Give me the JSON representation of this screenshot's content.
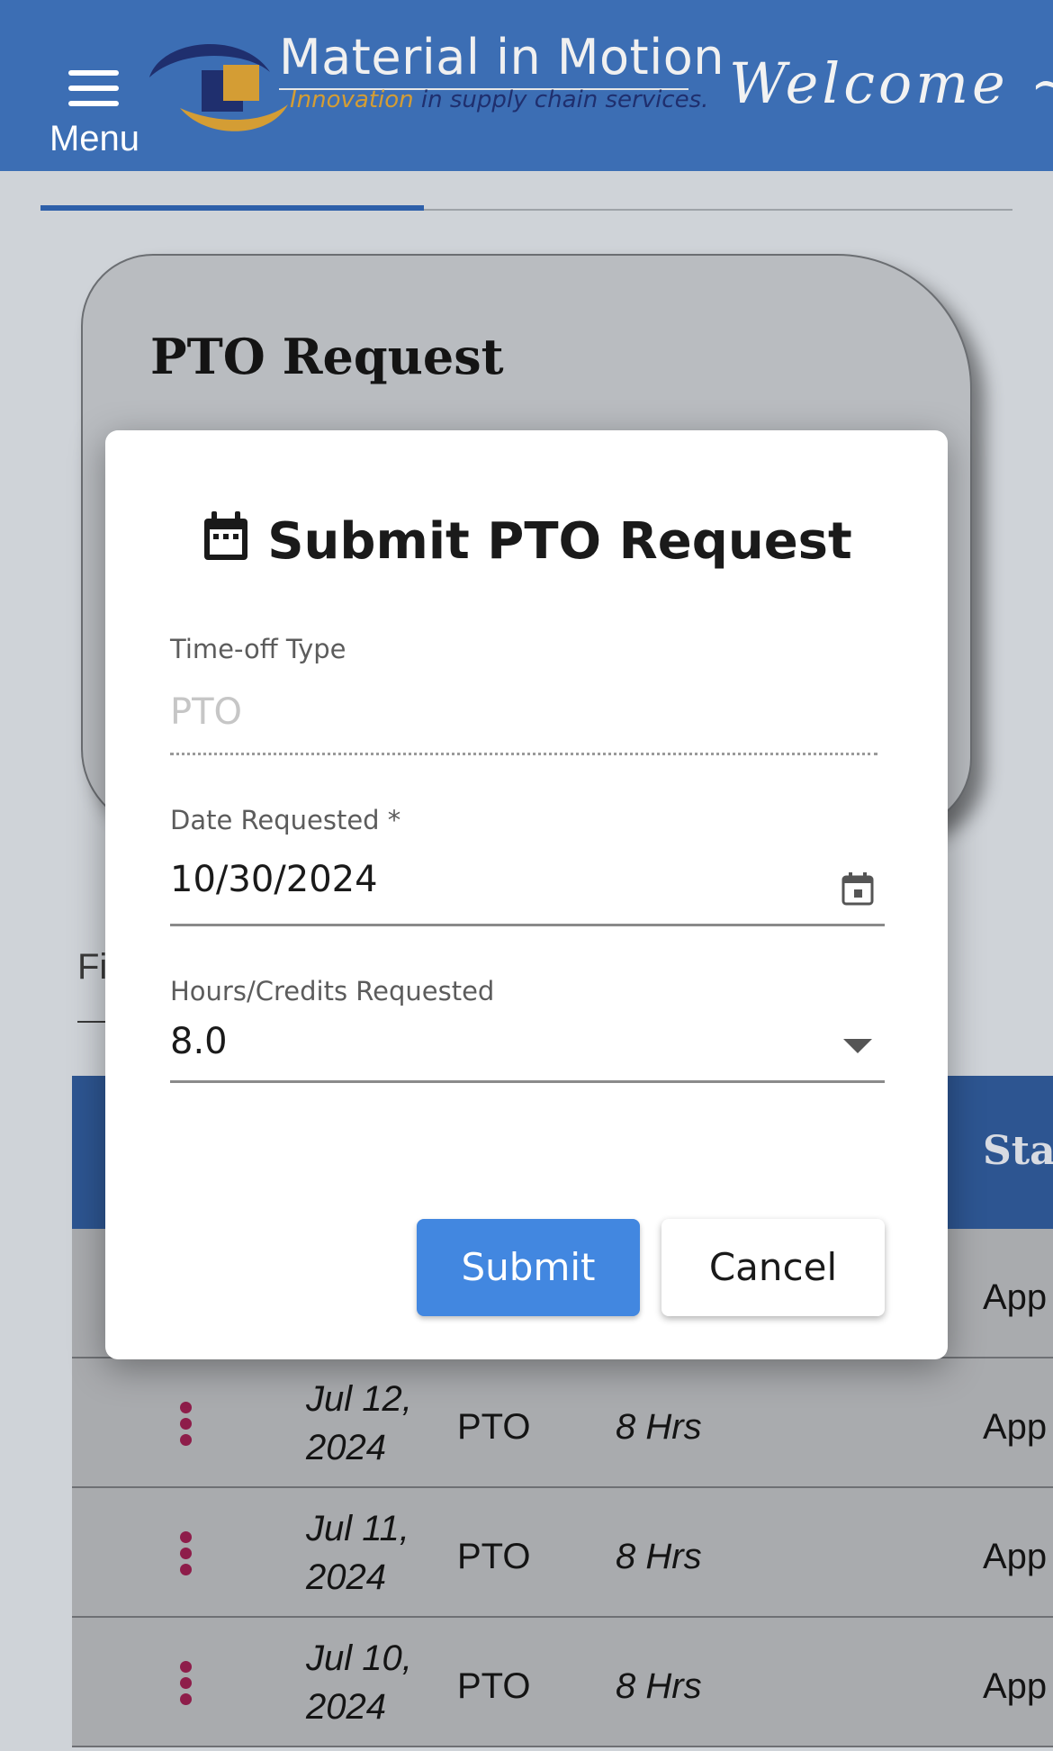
{
  "header": {
    "menu_label": "Menu",
    "logo_title": "Material in Motion",
    "logo_tagline_a": "Innovation",
    "logo_tagline_b": "in supply chain services.",
    "welcome_text": "Welcome ~ P"
  },
  "card": {
    "title": "PTO Request"
  },
  "filter_stub": "Fi",
  "table": {
    "status_header": "Sta",
    "rows": [
      {
        "date": "",
        "type": "",
        "hours": "",
        "status": "App"
      },
      {
        "date": "Jul 12, 2024",
        "type": "PTO",
        "hours": "8 Hrs",
        "status": "App"
      },
      {
        "date": "Jul 11, 2024",
        "type": "PTO",
        "hours": "8 Hrs",
        "status": "App"
      },
      {
        "date": "Jul 10, 2024",
        "type": "PTO",
        "hours": "8 Hrs",
        "status": "App"
      }
    ]
  },
  "dialog": {
    "title": "Submit PTO Request",
    "timeoff_label": "Time-off Type",
    "timeoff_value": "PTO",
    "date_label": "Date Requested *",
    "date_value": "10/30/2024",
    "hours_label": "Hours/Credits Requested",
    "hours_value": "8.0",
    "submit_label": "Submit",
    "cancel_label": "Cancel"
  },
  "colors": {
    "header_bg": "#3c6eb4",
    "submit_bg": "#4287e0",
    "kebab": "#8e1d4a",
    "table_header_bg": "#2d5591"
  }
}
